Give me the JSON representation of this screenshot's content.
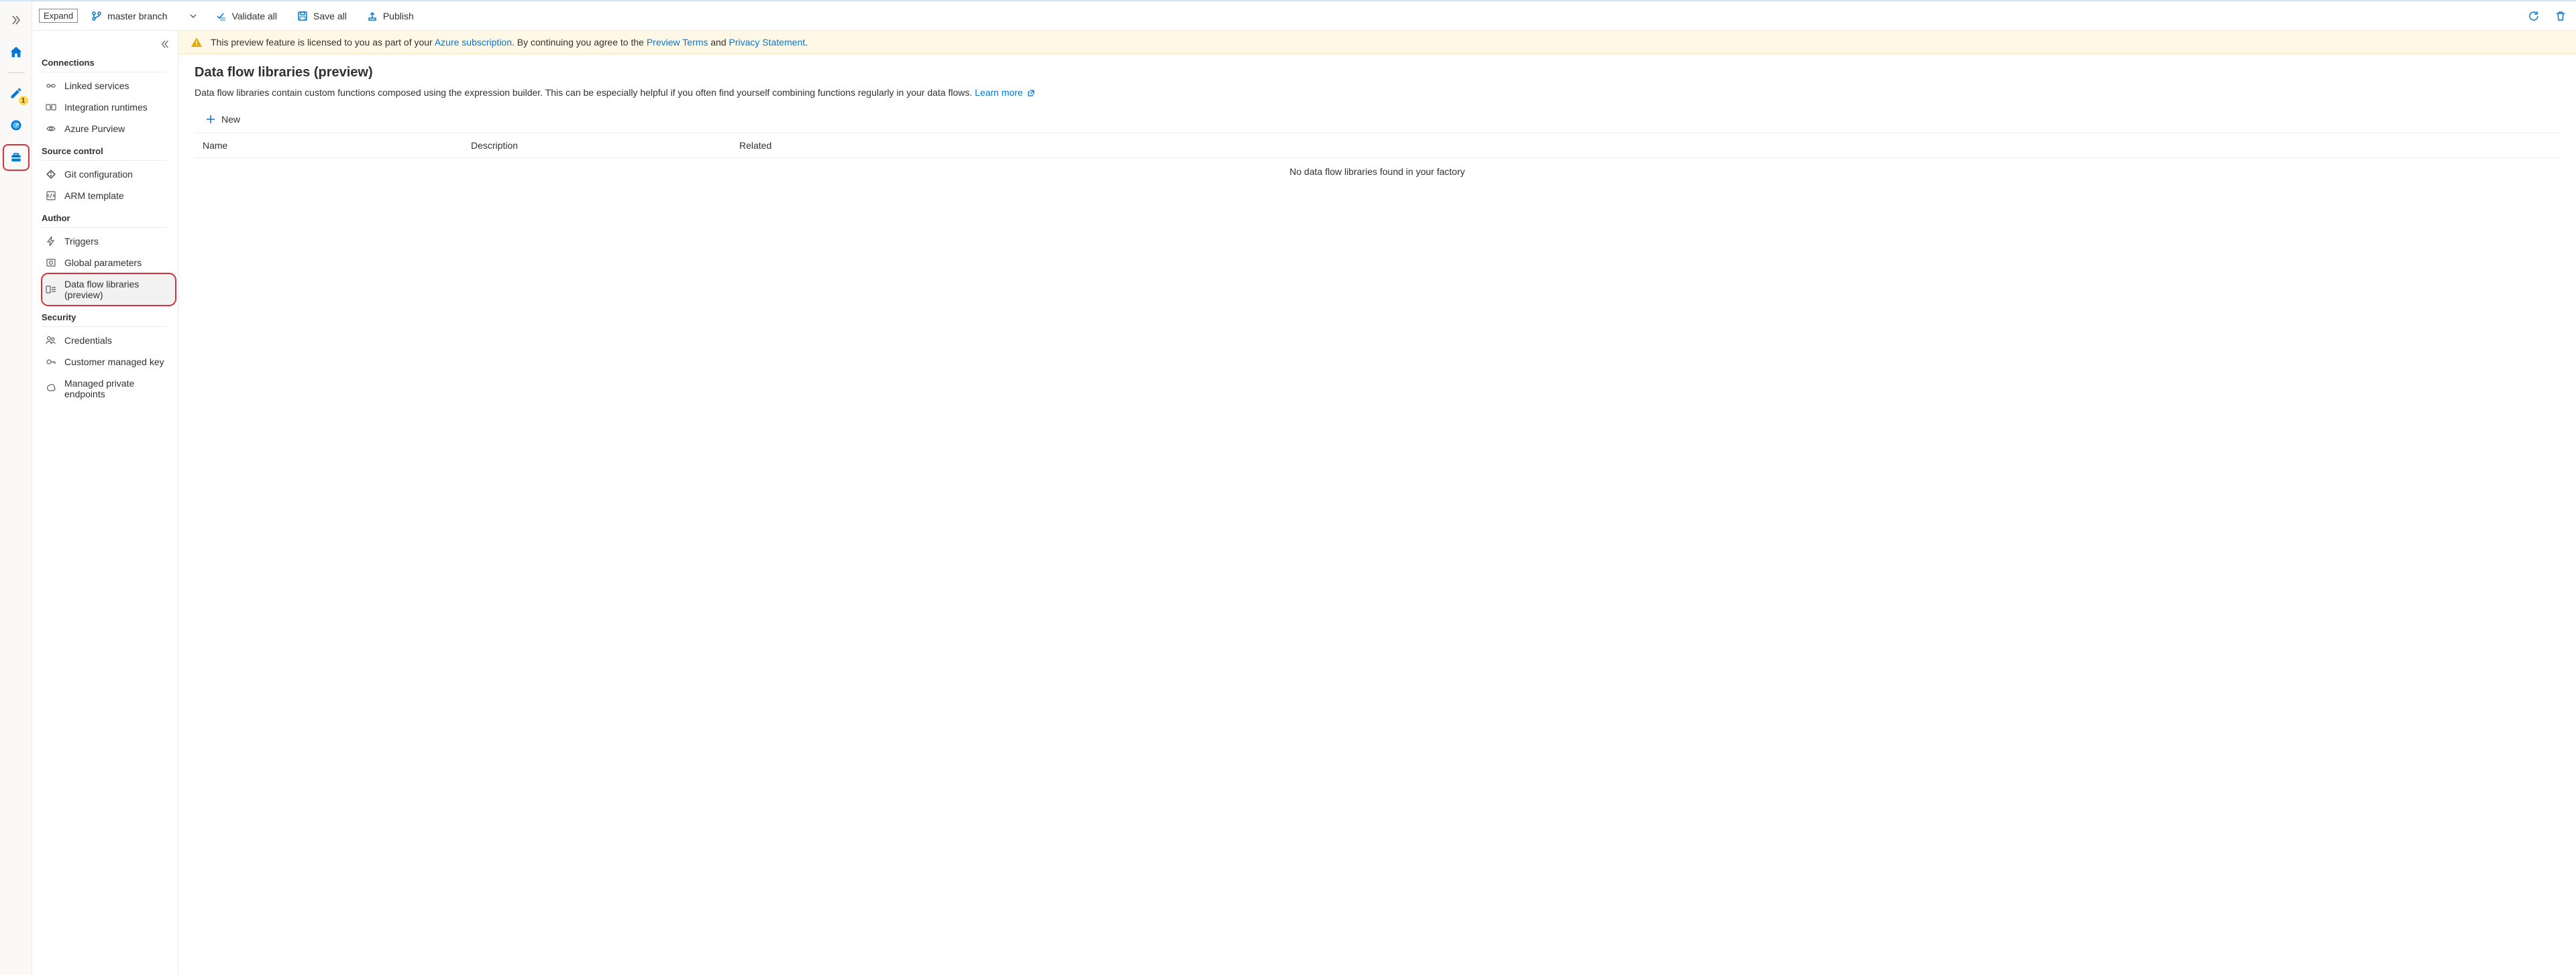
{
  "toolbar": {
    "expand_label": "Expand",
    "branch_label": "master branch",
    "validate_label": "Validate all",
    "save_label": "Save all",
    "publish_label": "Publish"
  },
  "rail": {
    "author_badge": "1"
  },
  "sidebar": {
    "groups": [
      {
        "title": "Connections",
        "items": [
          {
            "label": "Linked services",
            "icon": "linked"
          },
          {
            "label": "Integration runtimes",
            "icon": "ir"
          },
          {
            "label": "Azure Purview",
            "icon": "purview"
          }
        ]
      },
      {
        "title": "Source control",
        "items": [
          {
            "label": "Git configuration",
            "icon": "git"
          },
          {
            "label": "ARM template",
            "icon": "arm"
          }
        ]
      },
      {
        "title": "Author",
        "items": [
          {
            "label": "Triggers",
            "icon": "trigger"
          },
          {
            "label": "Global parameters",
            "icon": "params"
          },
          {
            "label": "Data flow libraries (preview)",
            "icon": "dfl",
            "selected": true
          }
        ]
      },
      {
        "title": "Security",
        "items": [
          {
            "label": "Credentials",
            "icon": "cred"
          },
          {
            "label": "Customer managed key",
            "icon": "key"
          },
          {
            "label": "Managed private endpoints",
            "icon": "endpoint"
          }
        ]
      }
    ]
  },
  "banner": {
    "pre": "This preview feature is licensed to you as part of your ",
    "link1": "Azure subscription",
    "mid": ". By continuing you agree to the ",
    "link2": "Preview Terms",
    "and": " and ",
    "link3": "Privacy Statement",
    "post": "."
  },
  "page": {
    "title": "Data flow libraries (preview)",
    "desc": "Data flow libraries contain custom functions composed using the expression builder. This can be especially helpful if you often find yourself combining functions regularly in your data flows. ",
    "learn_more": "Learn more",
    "new_label": "New",
    "columns": {
      "name": "Name",
      "desc": "Description",
      "rel": "Related"
    },
    "empty": "No data flow libraries found in your factory"
  }
}
